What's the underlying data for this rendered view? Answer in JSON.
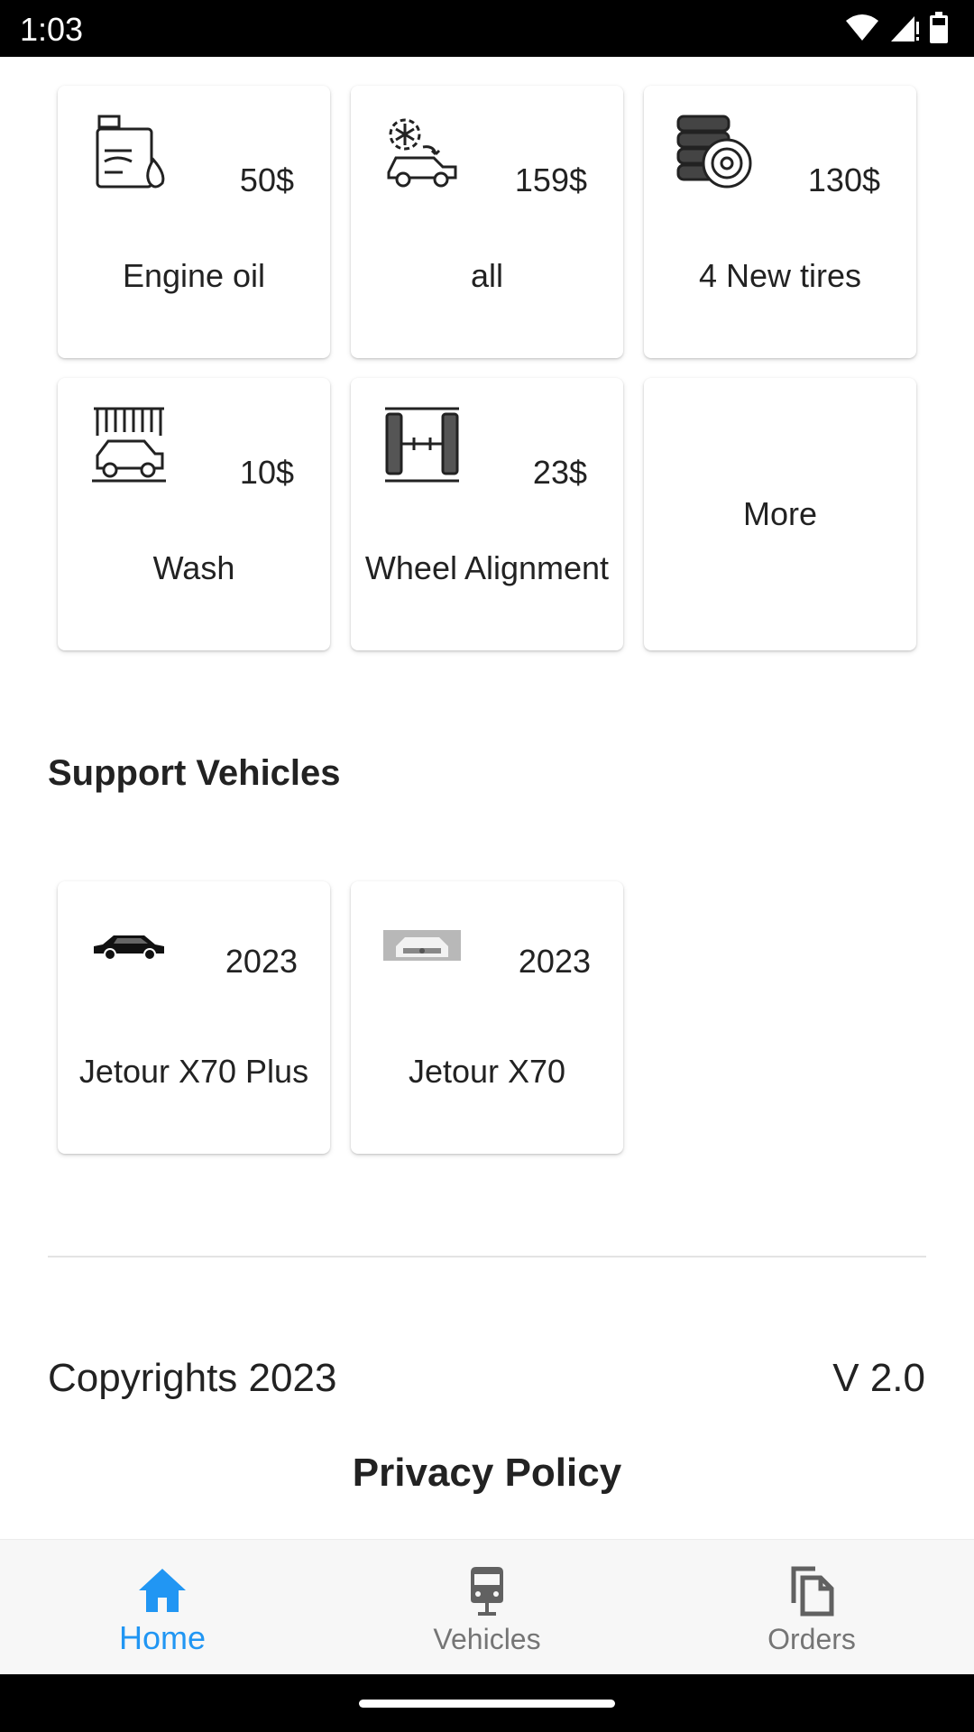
{
  "status_bar": {
    "time": "1:03"
  },
  "services": [
    {
      "price": "50$",
      "label": "Engine oil",
      "icon": "oil-can-icon"
    },
    {
      "price": "159$",
      "label": "all",
      "icon": "car-ac-icon"
    },
    {
      "price": "130$",
      "label": "4 New tires",
      "icon": "tires-icon"
    },
    {
      "price": "10$",
      "label": "Wash",
      "icon": "car-wash-icon"
    },
    {
      "price": "23$",
      "label": "Wheel Alignment",
      "icon": "wheel-alignment-icon"
    },
    {
      "label": "More"
    }
  ],
  "support_vehicles": {
    "title": "Support Vehicles",
    "items": [
      {
        "year": "2023",
        "name": "Jetour X70 Plus",
        "icon": "suv-icon"
      },
      {
        "year": "2023",
        "name": "Jetour X70",
        "icon": "car-photo-icon"
      }
    ]
  },
  "footer": {
    "copyright": "Copyrights 2023",
    "version": "V 2.0",
    "privacy": "Privacy Policy"
  },
  "bottom_nav": {
    "active_color": "#2196f3",
    "items": [
      {
        "label": "Home",
        "icon": "home-icon",
        "active": true
      },
      {
        "label": "Vehicles",
        "icon": "vehicle-icon",
        "active": false
      },
      {
        "label": "Orders",
        "icon": "orders-icon",
        "active": false
      }
    ]
  }
}
